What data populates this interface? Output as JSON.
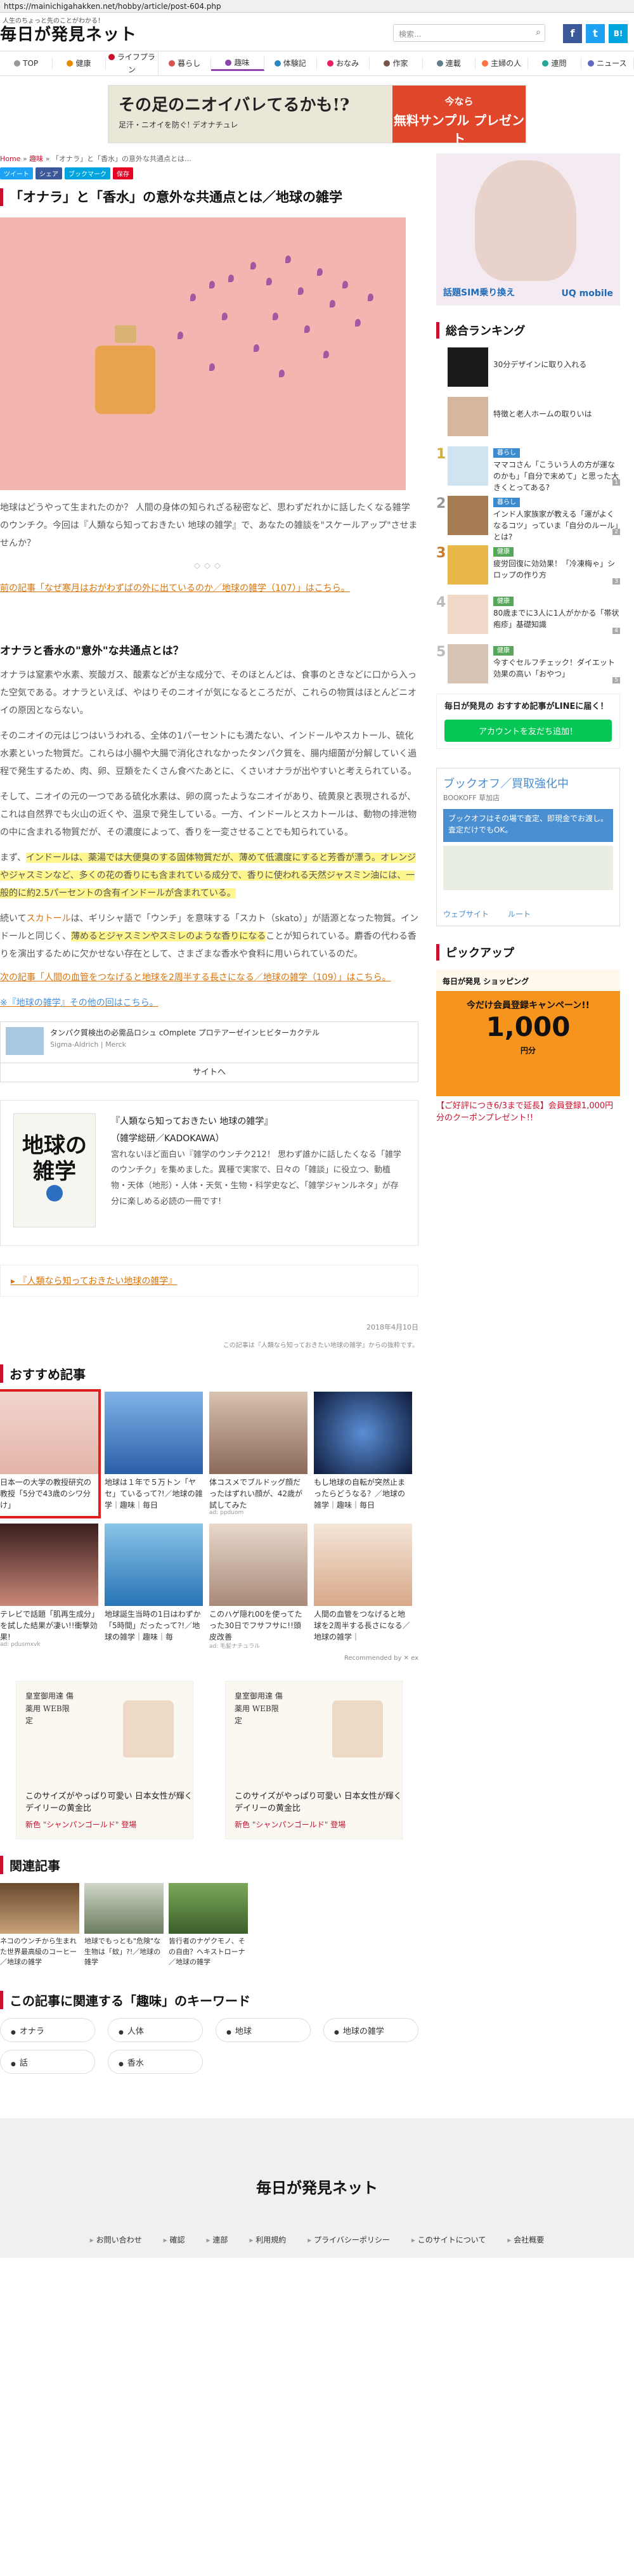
{
  "browser": {
    "url": "https://mainichigahakken.net/hobby/article/post-604.php"
  },
  "header": {
    "tagline": "人生のちょっと先のことがわかる！",
    "logo_text": "毎日が発見ネット",
    "search_placeholder": "検索...",
    "social": [
      "f",
      "t",
      "B!"
    ]
  },
  "nav": [
    "TOP",
    "健康",
    "ライフプラン",
    "暮らし",
    "趣味",
    "体験記",
    "おなみ",
    "作家",
    "連載",
    "主婦の人",
    "連問",
    "ニュース"
  ],
  "top_ad": {
    "headline": "その足のニオイバレてるかも!?",
    "sub": "足汗・ニオイを防ぐ! デオナチュレ",
    "cta1": "今なら",
    "cta2": "無料サンプル プレゼント"
  },
  "breadcrumb": [
    "Home",
    "趣味",
    "「オナラ」と「香水」の意外な共通点とは…"
  ],
  "share_buttons": [
    "ツイート",
    "シェア",
    "ブックマーク",
    "保存"
  ],
  "article": {
    "title": "「オナラ」と「香水」の意外な共通点とは／地球の雑学",
    "p1": "地球はどうやって生まれたのか？ 人間の身体の知られざる秘密など、思わずだれかに話したくなる雑学のウンチク。今回は『人類なら知っておきたい 地球の雑学』で、あなたの雑談を\"スケールアップ\"させませんか？",
    "diamonds": "◇◇◇",
    "prev_link": "前の記事「なぜ寒月はおがわずばの外に出ているのか／地球の雑学（107）」はこちら。",
    "h2": "オナラと香水の\"意外\"な共通点とは？",
    "p2": "オナラは窒素や水素、炭酸ガス、酸素などが主な成分で、そのほとんどは、食事のときなどに口から入った空気である。オナラといえば、やはりそのニオイが気になるところだが、これらの物質はほとんどニオイの原因とならない。",
    "p3": "そのニオイの元はじつはいうわれる、全体の1パーセントにも満たない、インドールやスカトール、硫化水素といった物質だ。これらは小腸や大腸で消化されなかったタンパク質を、腸内細菌が分解していく過程で発生するため、肉、卵、豆類をたくさん食べたあとに、くさいオナラが出やすいと考えられている。",
    "p4": "そして、ニオイの元の一つである硫化水素は、卵の腐ったようなニオイがあり、硫黄泉と表現されるが、これは自然界でも火山の近くや、温泉で発生している。一方、インドールとスカトールは、動物の排泄物の中に含まれる物質だが、その濃度によって、香りを一変させることでも知られている。",
    "p5_pre": "まず、",
    "p5_hl1": "インドールは、薬湯では大便臭のする固体物質だが、薄めて低濃度にすると芳香が漂う。オレンジやジャスミンなど、多くの花の香りにも含まれている成分で、香りに使われる天然ジャスミン油には、一般的に約2.5パーセントの含有インドールが含まれている。",
    "p6_pre": "続いて",
    "p6_word": "スカトール",
    "p6_mid": "は、ギリシャ語で「ウンチ」を意味する「スカト（skato）」が語源となった物質。インドールと同じく、",
    "p6_hl": "薄めるとジャスミンやスミレのような香りになる",
    "p6_post": "ことが知られている。麝香の代わる香りを演出するために欠かせない存在として、さまざまな香水や食料に用いられているのだ。",
    "next_link": "次の記事「人間の血管をつなげると地球を2周半する長さになる／地球の雑学（109）」はこちら。",
    "related_link_a": "※『地球の雑学』その他の回はこちら。",
    "date": "2018年4月10日",
    "credit": "この記事は『人類なら知っておきたい地球の雑学』からの抜粋です。"
  },
  "inline_ad": {
    "row1": "タンパク質検出の必需品ロシュ cOmplete プロテアーゼインヒビターカクテル",
    "row2": "Sigma-Aldrich | Merck",
    "cta": "サイトへ"
  },
  "book": {
    "cover_title": "地球の雑学",
    "title": "『人類なら知っておきたい 地球の雑学』",
    "publisher": "（雑学総研／KADOKAWA）",
    "desc": "宮れないほど面白い『雑学のウンチク212！ 思わず誰かに話したくなる「雑学のウンチク」を集めました。異種で実家で、日々の「雑談」に役立つ、動植物・天体（地形）・人体・天気・生物・科学史など、「雑学ジャンルネタ」が存分に楽しめる必読の一冊です!"
  },
  "ref_link": "▸ 『人類なら知っておきたい地球の雑学』",
  "recommend": {
    "heading": "おすすめ記事",
    "items": [
      {
        "cap": "日本一の大学の教授研究の教授「5分で43歳のシワ分け」",
        "src": ""
      },
      {
        "cap": "地球は１年で５万トン「ヤセ」ているって?!／地球の雑学｜趣味｜毎日",
        "src": ""
      },
      {
        "cap": "体コスメでブルドッグ顔だったはずれい顔が、42歳が試してみた",
        "src": "ad: ppduom"
      },
      {
        "cap": "もし地球の自転が突然止まったらどうなる？／地球の雑学｜趣味｜毎日",
        "src": ""
      },
      {
        "cap": "テレビで話題「肌再生成分」を試した結果が凄い!!衝撃効果!",
        "src": "ad: pdusmxvk"
      },
      {
        "cap": "地球誕生当時の1日はわずか「5時間」だったって?!／地球の雑学｜趣味｜毎",
        "src": ""
      },
      {
        "cap": "このハゲ隠れ00を使ってたった30日でフサフサに!!頭皮改善",
        "src": "ad: 毛髪ナチュラル"
      },
      {
        "cap": "人間の血管をつなげると地球を2周半する長さになる／地球の雑学｜",
        "src": ""
      }
    ],
    "recommended_by": "Recommended by ✕ ex"
  },
  "twin_ads": [
    {
      "tag": "皇室御用達 傷薬用 WEB限定",
      "copy": "このサイズがやっぱり可愛い 日本女性が輝くデイリーの黄金比",
      "copy2": "新色 \"シャンパンゴールド\" 登場"
    },
    {
      "tag": "皇室御用達 傷薬用 WEB限定",
      "copy": "このサイズがやっぱり可愛い 日本女性が輝くデイリーの黄金比",
      "copy2": "新色 \"シャンパンゴールド\" 登場"
    }
  ],
  "related": {
    "heading": "関連記事",
    "items": [
      {
        "cap": "ネコのウンチから生まれた世界最高級のコーヒー／地球の雑学"
      },
      {
        "cap": "地球でもっとも\"危険\"な生物は「蚊」?!／地球の雑学"
      },
      {
        "cap": "皆行者のナゲクモノ、その自由？ヘキストローナ／地球の雑学"
      }
    ]
  },
  "keywords": {
    "heading": "この記事に関連する「趣味」のキーワード",
    "items": [
      "オナラ",
      "人体",
      "地球",
      "地球の雑学",
      "話",
      "香水"
    ]
  },
  "sidebar": {
    "ad_text_l": "話題SIM乗り換え",
    "ad_text_r": "UQ mobile",
    "ranking_heading": "総合ランキング",
    "ranking": [
      {
        "num": "",
        "cat": "",
        "txt": "30分デザインに取り入れる",
        "pv": ""
      },
      {
        "num": "",
        "cat": "",
        "txt": "特徴と老人ホームの取りいは",
        "pv": ""
      },
      {
        "num": "1",
        "cat": "暮らし",
        "txt": "ママコさん「こういう人の方が運なのかも」「自分で末めて」と思った大きくとってある?",
        "pv": "1"
      },
      {
        "num": "2",
        "cat": "暮らし",
        "txt": "インド人家族家が教える「運がよくなるコツ」っていま「自分のルール」とは?",
        "pv": "2"
      },
      {
        "num": "3",
        "cat": "健康",
        "txt": "疲労回復に効効果！「冷凍梅ゃ」シロップの作り方",
        "pv": "3"
      },
      {
        "num": "4",
        "cat": "健康",
        "txt": "80歳までに3人に1人がかかる「帯状疱疹」基礎知識",
        "pv": "4"
      },
      {
        "num": "5",
        "cat": "健康",
        "txt": "今すぐセルフチェック！ダイエット効果の高い「おやつ」",
        "pv": "5"
      }
    ],
    "line_heading": "毎日が発見の おすすめ記事がLINEに届く！",
    "line_button": "アカウントを友だち追加！",
    "map_ad": {
      "title": "ブックオフ／買取強化中",
      "sub": "BOOKOFF 草加店",
      "banner": "ブックオフはその場で査定、即現金でお渡し。査定だけでもOK。",
      "btn1": "ウェブサイト",
      "btn2": "ルート"
    },
    "pickup_heading": "ピックアップ",
    "pickup": {
      "r1": "毎日が発見 ショッピング",
      "r2": "今だけ会員登録キャンペーン!!",
      "r3": "1,000",
      "r4": "円分"
    },
    "pickup_caption": "【ご好評につき6/3まで延長】会員登録1,000円分のクーポンプレゼント!!"
  },
  "footer": {
    "logo": "毎日が発見ネット",
    "links": [
      "お問い合わせ",
      "確認",
      "連部",
      "利用規約",
      "プライバシーポリシー",
      "このサイトについて",
      "会社概要"
    ]
  },
  "colors": {
    "brand_red": "#c8102e",
    "link_orange": "#d8740a",
    "line_green": "#06c755",
    "highlight": "#fff68f"
  }
}
